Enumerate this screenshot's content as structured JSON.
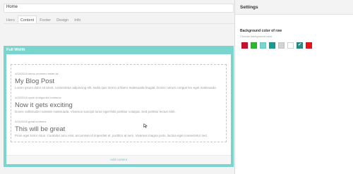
{
  "topbar": {
    "label": "Home"
  },
  "tabs": [
    {
      "label": "Hero",
      "active": false
    },
    {
      "label": "Content",
      "active": true
    },
    {
      "label": "Footer",
      "active": false
    },
    {
      "label": "Design",
      "active": false
    },
    {
      "label": "Info",
      "active": false
    }
  ],
  "row": {
    "label": "Full Width",
    "add_content": "Add content",
    "posts": [
      {
        "meta": "4/15/2018 demo umtmmz tester kk",
        "title": "My Blog Post",
        "body": "Lorem ipsum dolor sit amet, consectetur adipiscing elit. Nulla quis lorem ut libero malesuada feugiat. Donec rutrum congue leo eget malesuada."
      },
      {
        "meta": "4/15/2018 cycle umtigorden umtmmz",
        "title": "Now it gets exciting",
        "body": "Donec sollicitudin molestie malesuada. Vivamus suscipit tortor eget felis porttitor volutpat. Sed porttitor lectus nibh."
      },
      {
        "meta": "4/15/2018 great umtmmz",
        "title": "This will be great",
        "body": "Proin eget tortor risus. Curabitur arcu erat, accumsan id imperdiet et, porttitor at sem. Vivamus magna justo, lacinia eget consectetur sed."
      }
    ]
  },
  "settings": {
    "title": "Settings",
    "bg_title": "Background color of row",
    "bg_subtitle": "Choose background color",
    "swatches": [
      {
        "color": "#c8102e",
        "selected": false
      },
      {
        "color": "#2db82d",
        "selected": false
      },
      {
        "color": "#79d6cf",
        "selected": false
      },
      {
        "color": "#1a9b92",
        "selected": false
      },
      {
        "color": "#d3d3d3",
        "selected": false
      },
      {
        "color": "#ffffff",
        "selected": false
      },
      {
        "color": "#2c8a84",
        "selected": true
      },
      {
        "color": "#e8141b",
        "selected": false
      }
    ]
  }
}
